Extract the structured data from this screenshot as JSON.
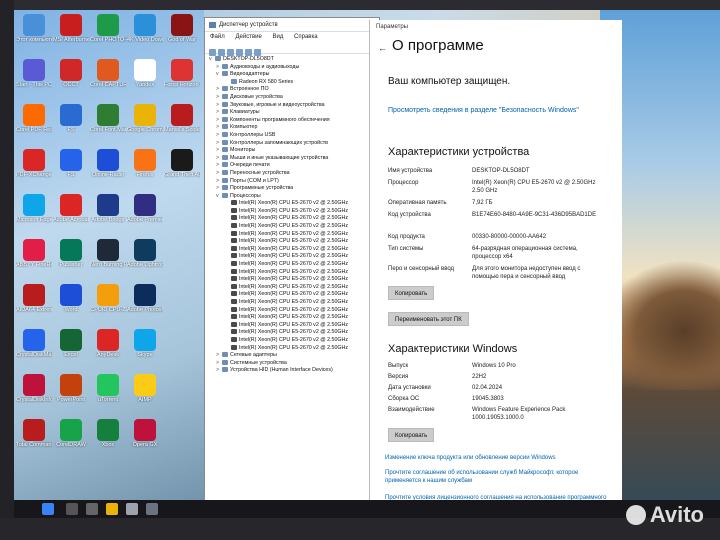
{
  "desktop": {
    "icons": [
      {
        "label": "Этот компьютер",
        "color": "#4a90d9"
      },
      {
        "label": "MSI Afterburner",
        "color": "#c81e1e"
      },
      {
        "label": "Corel PHOTO-PA...",
        "color": "#1d9b48"
      },
      {
        "label": "4K Video Downloader",
        "color": "#2c8fd9"
      },
      {
        "label": "God of War",
        "color": "#8a1414"
      },
      {
        "label": "Start - This PC",
        "color": "#5a5ad6"
      },
      {
        "label": "OCCT",
        "color": "#d02828"
      },
      {
        "label": "Corel CAPTURE",
        "color": "#e05a20"
      },
      {
        "label": "Yandex",
        "color": "#ffffff"
      },
      {
        "label": "Forza Horizon 4",
        "color": "#d33"
      },
      {
        "label": "Corel PDF Reader",
        "color": "#ff6a00"
      },
      {
        "label": "FS",
        "color": "#2a6bd1"
      },
      {
        "label": "Corel Font Manager",
        "color": "#2e7d32"
      },
      {
        "label": "Google Chrome",
        "color": "#eab308"
      },
      {
        "label": "Marvel's Spider-Man",
        "color": "#b91c1c"
      },
      {
        "label": "PDF-XChange Viewer",
        "color": "#dc2626"
      },
      {
        "label": "FS",
        "color": "#2563eb"
      },
      {
        "label": "Online-Radio",
        "color": "#1d4ed8"
      },
      {
        "label": "Firefox",
        "color": "#f97316"
      },
      {
        "label": "Grand Theft Auto V",
        "color": "#1a1a1a"
      },
      {
        "label": "Microsoft Edge",
        "color": "#0ea5e9"
      },
      {
        "label": "Adobe Acrobat",
        "color": "#dc2626"
      },
      {
        "label": "Adobe Bridge",
        "color": "#1e3a8a"
      },
      {
        "label": "Adobe Premiere Pro",
        "color": "#312e81"
      },
      {
        "label": "",
        "color": "#000000"
      },
      {
        "label": "ABBYY FineReader",
        "color": "#e11d48"
      },
      {
        "label": "Publisher",
        "color": "#047857"
      },
      {
        "label": "Nero Burning ROM",
        "color": "#1f2937"
      },
      {
        "label": "Adobe Lightroom",
        "color": "#0f3b5f"
      },
      {
        "label": "",
        "color": "#000000"
      },
      {
        "label": "AIDA64 Extreme",
        "color": "#b91c1c"
      },
      {
        "label": "Word",
        "color": "#1d4ed8"
      },
      {
        "label": "CPUID CPU-Z",
        "color": "#f59e0b"
      },
      {
        "label": "Adobe Photoshop",
        "color": "#0c2c5c"
      },
      {
        "label": "",
        "color": "#000000"
      },
      {
        "label": "CrystalDiskMark",
        "color": "#2563eb"
      },
      {
        "label": "Excel",
        "color": "#166534"
      },
      {
        "label": "AnyDesk",
        "color": "#dc2626"
      },
      {
        "label": "Skype",
        "color": "#0ea5e9"
      },
      {
        "label": "",
        "color": "#000000"
      },
      {
        "label": "CrystalDiskInfo",
        "color": "#be123c"
      },
      {
        "label": "PowerPoint",
        "color": "#c2410c"
      },
      {
        "label": "uTorrent",
        "color": "#22c55e"
      },
      {
        "label": "AIMP",
        "color": "#facc15"
      },
      {
        "label": "",
        "color": "#000000"
      },
      {
        "label": "Total Commander",
        "color": "#b91c1c"
      },
      {
        "label": "CorelDRAW",
        "color": "#16a34a"
      },
      {
        "label": "Xbox",
        "color": "#15803d"
      },
      {
        "label": "Opera GX",
        "color": "#be123c"
      }
    ]
  },
  "devmgr": {
    "title": "Диспетчер устройств",
    "menu": [
      "Файл",
      "Действие",
      "Вид",
      "Справка"
    ],
    "tree": [
      {
        "lvl": 0,
        "toggle": "v",
        "label": "DESKTOP-DL5O8DT"
      },
      {
        "lvl": 1,
        "toggle": ">",
        "label": "Аудиовходы и аудиовыходы"
      },
      {
        "lvl": 1,
        "toggle": "v",
        "label": "Видеоадаптеры"
      },
      {
        "lvl": 2,
        "toggle": "",
        "label": "Radeon RX 580 Series"
      },
      {
        "lvl": 1,
        "toggle": ">",
        "label": "Встроенное ПО"
      },
      {
        "lvl": 1,
        "toggle": ">",
        "label": "Дисковые устройства"
      },
      {
        "lvl": 1,
        "toggle": ">",
        "label": "Звуковые, игровые и видеоустройства"
      },
      {
        "lvl": 1,
        "toggle": ">",
        "label": "Клавиатуры"
      },
      {
        "lvl": 1,
        "toggle": ">",
        "label": "Компоненты программного обеспечения"
      },
      {
        "lvl": 1,
        "toggle": ">",
        "label": "Компьютер"
      },
      {
        "lvl": 1,
        "toggle": ">",
        "label": "Контроллеры USB"
      },
      {
        "lvl": 1,
        "toggle": ">",
        "label": "Контроллеры запоминающих устройств"
      },
      {
        "lvl": 1,
        "toggle": ">",
        "label": "Мониторы"
      },
      {
        "lvl": 1,
        "toggle": ">",
        "label": "Мыши и иные указывающие устройства"
      },
      {
        "lvl": 1,
        "toggle": ">",
        "label": "Очереди печати"
      },
      {
        "lvl": 1,
        "toggle": ">",
        "label": "Переносные устройства"
      },
      {
        "lvl": 1,
        "toggle": ">",
        "label": "Порты (COM и LPT)"
      },
      {
        "lvl": 1,
        "toggle": ">",
        "label": "Программные устройства"
      },
      {
        "lvl": 1,
        "toggle": "v",
        "label": "Процессоры"
      },
      {
        "lvl": 2,
        "toggle": "",
        "label": "Intel(R) Xeon(R) CPU E5-2670 v2 @ 2.50GHz",
        "proc": true
      },
      {
        "lvl": 2,
        "toggle": "",
        "label": "Intel(R) Xeon(R) CPU E5-2670 v2 @ 2.50GHz",
        "proc": true
      },
      {
        "lvl": 2,
        "toggle": "",
        "label": "Intel(R) Xeon(R) CPU E5-2670 v2 @ 2.50GHz",
        "proc": true
      },
      {
        "lvl": 2,
        "toggle": "",
        "label": "Intel(R) Xeon(R) CPU E5-2670 v2 @ 2.50GHz",
        "proc": true
      },
      {
        "lvl": 2,
        "toggle": "",
        "label": "Intel(R) Xeon(R) CPU E5-2670 v2 @ 2.50GHz",
        "proc": true
      },
      {
        "lvl": 2,
        "toggle": "",
        "label": "Intel(R) Xeon(R) CPU E5-2670 v2 @ 2.50GHz",
        "proc": true
      },
      {
        "lvl": 2,
        "toggle": "",
        "label": "Intel(R) Xeon(R) CPU E5-2670 v2 @ 2.50GHz",
        "proc": true
      },
      {
        "lvl": 2,
        "toggle": "",
        "label": "Intel(R) Xeon(R) CPU E5-2670 v2 @ 2.50GHz",
        "proc": true
      },
      {
        "lvl": 2,
        "toggle": "",
        "label": "Intel(R) Xeon(R) CPU E5-2670 v2 @ 2.50GHz",
        "proc": true
      },
      {
        "lvl": 2,
        "toggle": "",
        "label": "Intel(R) Xeon(R) CPU E5-2670 v2 @ 2.50GHz",
        "proc": true
      },
      {
        "lvl": 2,
        "toggle": "",
        "label": "Intel(R) Xeon(R) CPU E5-2670 v2 @ 2.50GHz",
        "proc": true
      },
      {
        "lvl": 2,
        "toggle": "",
        "label": "Intel(R) Xeon(R) CPU E5-2670 v2 @ 2.50GHz",
        "proc": true
      },
      {
        "lvl": 2,
        "toggle": "",
        "label": "Intel(R) Xeon(R) CPU E5-2670 v2 @ 2.50GHz",
        "proc": true
      },
      {
        "lvl": 2,
        "toggle": "",
        "label": "Intel(R) Xeon(R) CPU E5-2670 v2 @ 2.50GHz",
        "proc": true
      },
      {
        "lvl": 2,
        "toggle": "",
        "label": "Intel(R) Xeon(R) CPU E5-2670 v2 @ 2.50GHz",
        "proc": true
      },
      {
        "lvl": 2,
        "toggle": "",
        "label": "Intel(R) Xeon(R) CPU E5-2670 v2 @ 2.50GHz",
        "proc": true
      },
      {
        "lvl": 2,
        "toggle": "",
        "label": "Intel(R) Xeon(R) CPU E5-2670 v2 @ 2.50GHz",
        "proc": true
      },
      {
        "lvl": 2,
        "toggle": "",
        "label": "Intel(R) Xeon(R) CPU E5-2670 v2 @ 2.50GHz",
        "proc": true
      },
      {
        "lvl": 2,
        "toggle": "",
        "label": "Intel(R) Xeon(R) CPU E5-2670 v2 @ 2.50GHz",
        "proc": true
      },
      {
        "lvl": 2,
        "toggle": "",
        "label": "Intel(R) Xeon(R) CPU E5-2670 v2 @ 2.50GHz",
        "proc": true
      },
      {
        "lvl": 1,
        "toggle": ">",
        "label": "Сетевые адаптеры"
      },
      {
        "lvl": 1,
        "toggle": ">",
        "label": "Системные устройства"
      },
      {
        "lvl": 1,
        "toggle": ">",
        "label": "Устройства HID (Human Interface Devices)"
      }
    ]
  },
  "settings": {
    "window_title": "Параметры",
    "back_glyph": "←",
    "page_title": "О программе",
    "protected": "Ваш компьютер защищен.",
    "security_link": "Просмотреть сведения в разделе \"Безопасность Windows\"",
    "device_specs_heading": "Характеристики устройства",
    "device_specs": [
      {
        "key": "Имя устройства",
        "value": "DESKTOP-DL5O8DT"
      },
      {
        "key": "Процессор",
        "value": "Intel(R) Xeon(R) CPU E5-2670 v2 @ 2.50GHz   2.50 GHz"
      },
      {
        "key": "Оперативная память",
        "value": "7,92 ГБ"
      },
      {
        "key": "Код устройства",
        "value": "B1E74E60-8480-4A9E-9C31-436D95BAD1DE"
      },
      {
        "key": "Код продукта",
        "value": "00330-80000-00000-AA642"
      },
      {
        "key": "Тип системы",
        "value": "64-разрядная операционная система, процессор x64"
      },
      {
        "key": "Перо и сенсорный ввод",
        "value": "Для этого монитора недоступен ввод с помощью пера и сенсорный ввод"
      }
    ],
    "copy_button": "Копировать",
    "rename_button": "Переименовать этот ПК",
    "win_specs_heading": "Характеристики Windows",
    "win_specs": [
      {
        "key": "Выпуск",
        "value": "Windows 10 Pro"
      },
      {
        "key": "Версия",
        "value": "22H2"
      },
      {
        "key": "Дата установки",
        "value": "02.04.2024"
      },
      {
        "key": "Сборка ОС",
        "value": "19045.3803"
      },
      {
        "key": "Взаимодействие",
        "value": "Windows Feature Experience Pack 1000.19053.1000.0"
      }
    ],
    "copy_button2": "Копировать",
    "links": [
      "Изменение ключа продукта или обновление версии Windows",
      "Прочтите соглашение об использовании служб Майкрософт, которое применяется к нашим службам",
      "Прочтите условия лицензионного соглашения на использование программного обеспечения корпорации Майкрософт"
    ]
  },
  "watermark": "Avito"
}
